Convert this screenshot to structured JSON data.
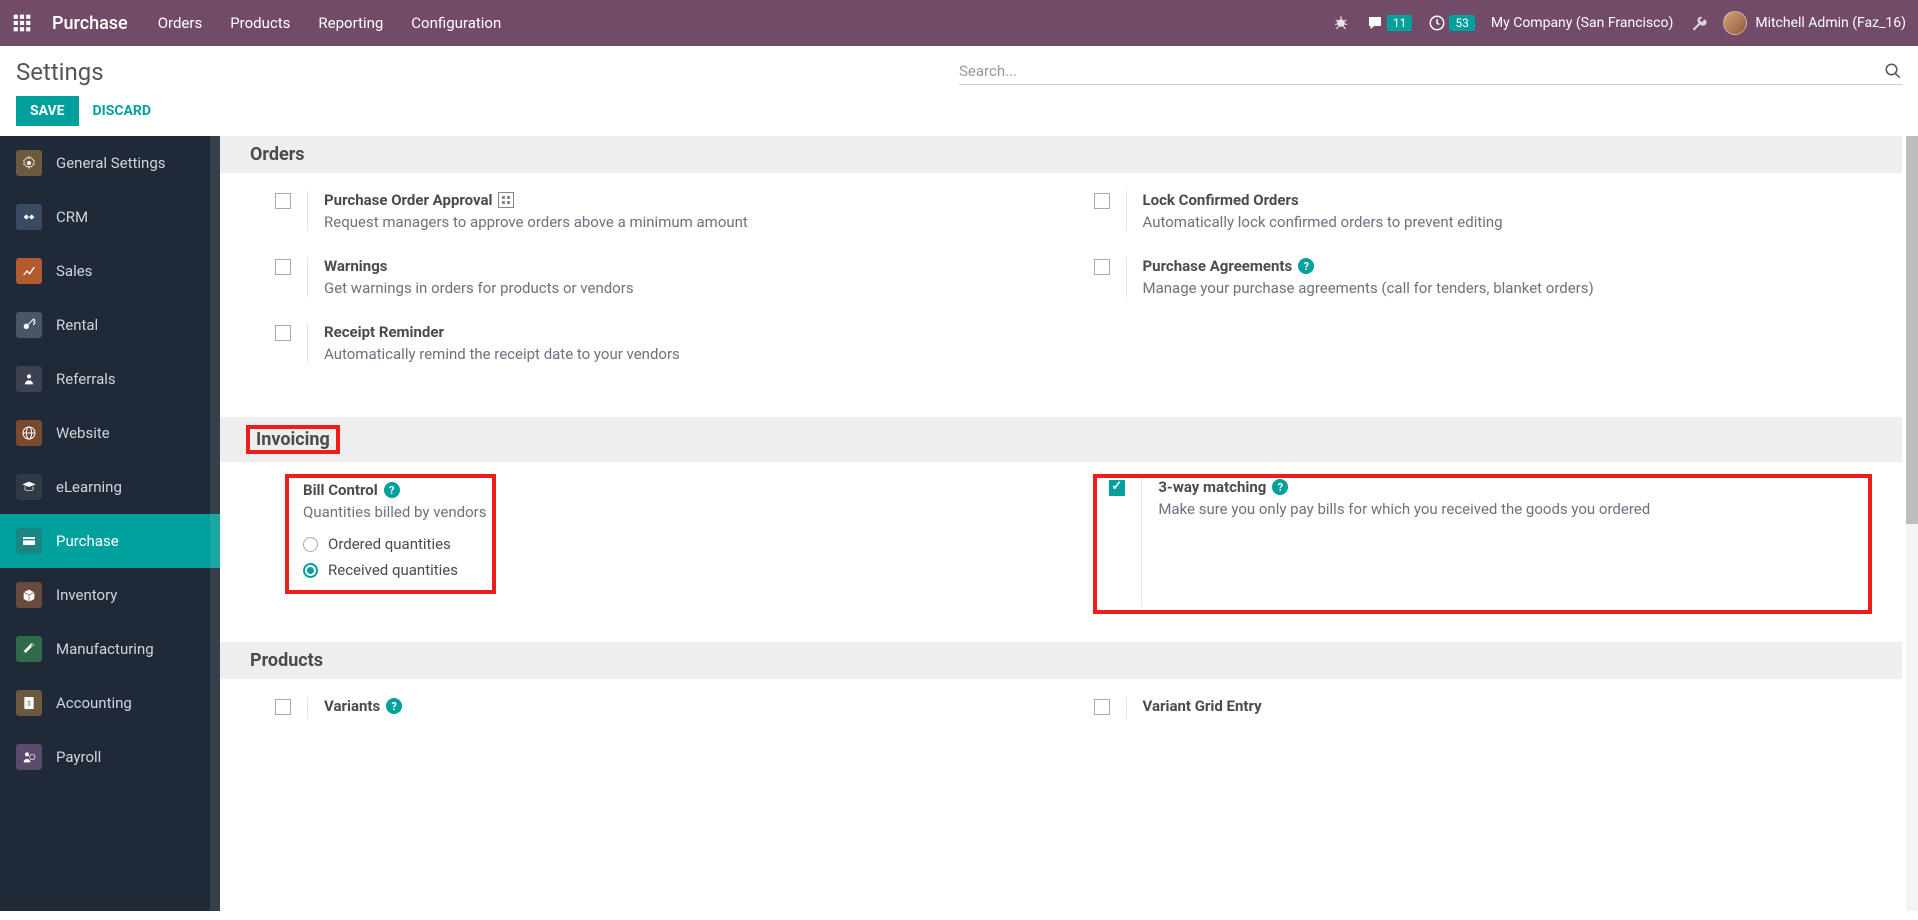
{
  "topbar": {
    "app_title": "Purchase",
    "nav": [
      "Orders",
      "Products",
      "Reporting",
      "Configuration"
    ],
    "msg_count": "11",
    "clock_count": "53",
    "company": "My Company (San Francisco)",
    "user": "Mitchell Admin (Faz_16)"
  },
  "control_panel": {
    "title": "Settings",
    "save": "SAVE",
    "discard": "DISCARD",
    "search_placeholder": "Search..."
  },
  "sidebar": {
    "items": [
      {
        "label": "General Settings",
        "icon_bg": "#6b5b3e"
      },
      {
        "label": "CRM",
        "icon_bg": "#3b4a63"
      },
      {
        "label": "Sales",
        "icon_bg": "#b35a2e"
      },
      {
        "label": "Rental",
        "icon_bg": "#4a5568"
      },
      {
        "label": "Referrals",
        "icon_bg": "#3b4250"
      },
      {
        "label": "Website",
        "icon_bg": "#7a4a2e"
      },
      {
        "label": "eLearning",
        "icon_bg": "#2f3a44"
      },
      {
        "label": "Purchase",
        "icon_bg": "#00a09d",
        "active": true
      },
      {
        "label": "Inventory",
        "icon_bg": "#6b4a3e"
      },
      {
        "label": "Manufacturing",
        "icon_bg": "#2f6b4a"
      },
      {
        "label": "Accounting",
        "icon_bg": "#6b5a3e"
      },
      {
        "label": "Payroll",
        "icon_bg": "#5a4a6b"
      }
    ]
  },
  "sections": {
    "orders": {
      "title": "Orders",
      "left": [
        {
          "title": "Purchase Order Approval",
          "desc": "Request managers to approve orders above a minimum amount",
          "enterprise": true
        },
        {
          "title": "Warnings",
          "desc": "Get warnings in orders for products or vendors"
        },
        {
          "title": "Receipt Reminder",
          "desc": "Automatically remind the receipt date to your vendors"
        }
      ],
      "right": [
        {
          "title": "Lock Confirmed Orders",
          "desc": "Automatically lock confirmed orders to prevent editing"
        },
        {
          "title": "Purchase Agreements",
          "desc": "Manage your purchase agreements (call for tenders, blanket orders)",
          "help": true
        }
      ]
    },
    "invoicing": {
      "title": "Invoicing",
      "bill_control": {
        "title": "Bill Control",
        "desc": "Quantities billed by vendors",
        "opt_ordered": "Ordered quantities",
        "opt_received": "Received quantities"
      },
      "three_way": {
        "title": "3-way matching",
        "desc": "Make sure you only pay bills for which you received the goods you ordered"
      }
    },
    "products": {
      "title": "Products",
      "variants": {
        "title": "Variants"
      },
      "grid": {
        "title": "Variant Grid Entry"
      }
    }
  }
}
